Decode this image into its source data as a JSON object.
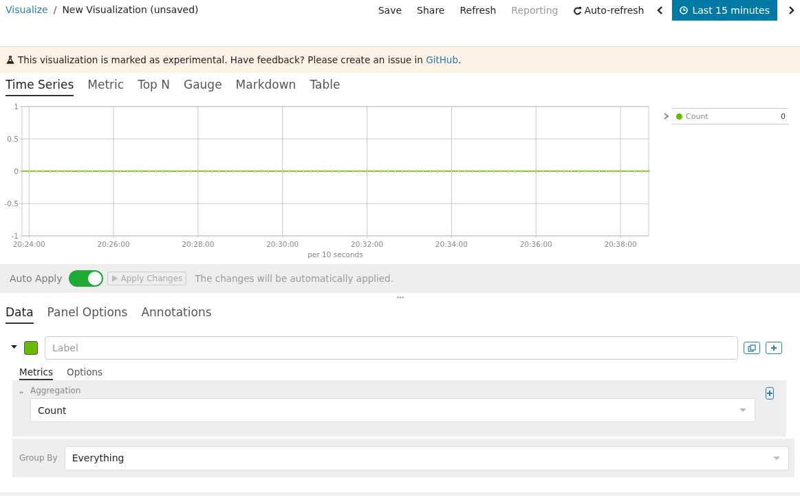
{
  "breadcrumb": {
    "link": "Visualize",
    "separator": "/",
    "title": "New Visualization (unsaved)"
  },
  "top_menu": [
    {
      "kind": "text",
      "label": "Save",
      "disabled": false
    },
    {
      "kind": "text",
      "label": "Share",
      "disabled": false
    },
    {
      "kind": "text",
      "label": "Refresh",
      "disabled": false
    },
    {
      "kind": "text",
      "label": "Reporting",
      "disabled": true
    },
    {
      "kind": "refresh",
      "label": "Auto-refresh",
      "disabled": false
    },
    {
      "kind": "prev"
    },
    {
      "kind": "time",
      "label": "Last 15 minutes",
      "disabled": false
    },
    {
      "kind": "next"
    }
  ],
  "banner": {
    "text": "This visualization is marked as experimental. Have feedback? Please create an issue in ",
    "link": "GitHub",
    "after": "."
  },
  "vis_tabs": [
    {
      "label": "Time Series",
      "selected": true
    },
    {
      "label": "Metric",
      "selected": false
    },
    {
      "label": "Top N",
      "selected": false
    },
    {
      "label": "Gauge",
      "selected": false
    },
    {
      "label": "Markdown",
      "selected": false
    },
    {
      "label": "Table",
      "selected": false
    }
  ],
  "chart": {
    "chart_data": {
      "type": "line",
      "xlabel": "per 10 seconds",
      "categories": [
        null,
        "20:24:00",
        null,
        null,
        null,
        null,
        null,
        null,
        null,
        null,
        null,
        null,
        null,
        "20:26:00",
        null,
        null,
        null,
        null,
        null,
        null,
        null,
        null,
        null,
        null,
        null,
        "20:28:00",
        null,
        null,
        null,
        null,
        null,
        null,
        null,
        null,
        null,
        null,
        null,
        "20:30:00",
        null,
        null,
        null,
        null,
        null,
        null,
        null,
        null,
        null,
        null,
        null,
        "20:32:00",
        null,
        null,
        null,
        null,
        null,
        null,
        null,
        null,
        null,
        null,
        null,
        "20:34:00",
        null,
        null,
        null,
        null,
        null,
        null,
        null,
        null,
        null,
        null,
        null,
        "20:36:00",
        null,
        null,
        null,
        null,
        null,
        null,
        null,
        null,
        null,
        null,
        null,
        "20:38:00",
        null,
        null,
        null,
        null
      ],
      "series": [
        {
          "name": "Count",
          "color": "#68bc00",
          "marker": "circle",
          "values": [
            0,
            0,
            0,
            0,
            0,
            0,
            0,
            0,
            0,
            0,
            0,
            0,
            0,
            0,
            0,
            0,
            0,
            0,
            0,
            0,
            0,
            0,
            0,
            0,
            0,
            0,
            0,
            0,
            0,
            0,
            0,
            0,
            0,
            0,
            0,
            0,
            0,
            0,
            0,
            0,
            0,
            0,
            0,
            0,
            0,
            0,
            0,
            0,
            0,
            0,
            0,
            0,
            0,
            0,
            0,
            0,
            0,
            0,
            0,
            0,
            0,
            0,
            0,
            0,
            0,
            0,
            0,
            0,
            0,
            0,
            0,
            0,
            0,
            0,
            0,
            0,
            0,
            0,
            0,
            0,
            0,
            0,
            0,
            0,
            0,
            0,
            0,
            0,
            0,
            0
          ]
        }
      ],
      "ylim": [
        -1,
        1
      ],
      "grid": true,
      "yticks": [
        {
          "value": 1,
          "label": "1"
        },
        {
          "value": 0.5,
          "label": "0.5"
        },
        {
          "value": 0,
          "label": "0"
        },
        {
          "value": -0.5,
          "label": "-0.5"
        },
        {
          "value": -1,
          "label": "-1"
        }
      ]
    },
    "legend": [
      {
        "value": "0"
      }
    ]
  },
  "apply_bar": {
    "label": "Auto Apply",
    "auto_apply": true,
    "button": "Apply Changes",
    "button_disabled": true,
    "message": "The changes will be automatically applied."
  },
  "editor_tabs": [
    {
      "label": "Data",
      "selected": true
    },
    {
      "label": "Panel Options",
      "selected": false
    },
    {
      "label": "Annotations",
      "selected": false
    }
  ],
  "series_row": {
    "expanded": true,
    "color": "#68bc00",
    "placeholder": "Label"
  },
  "sub_tabs": [
    {
      "label": "Metrics",
      "selected": true
    },
    {
      "label": "Options",
      "selected": false
    }
  ],
  "metric": {
    "label": "Aggregation",
    "value": "Count"
  },
  "group_by": {
    "label": "Group By",
    "value": "Everything"
  }
}
